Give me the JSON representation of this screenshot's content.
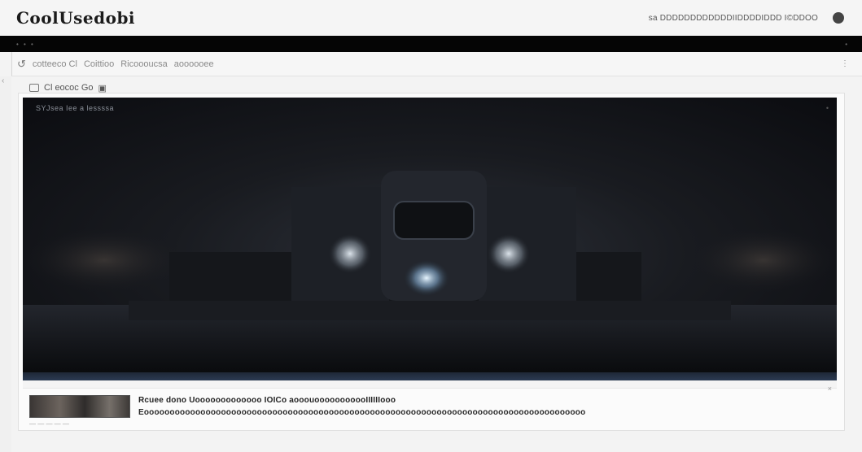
{
  "app": {
    "brand": "CoolUsedobi",
    "header_links": "sa DDDDDDDDDDDDIIDDDDIDDD I©DDOO",
    "profile_icon": "profile-circle-icon"
  },
  "strip": {
    "left": "• • •",
    "right": "•"
  },
  "toolbar": {
    "back_icon": "↺",
    "items": [
      "cotteeco Cl",
      "Coittioo",
      "Ricoooucsa",
      "aoooooee"
    ],
    "menu_icon": "⋮"
  },
  "player": {
    "header_label": "Cl eococ Go",
    "header_icon2": "▣",
    "video_title": "SYJsea Iee a lessssa",
    "corner_text": "•",
    "progress": 0.0
  },
  "item": {
    "title": "Rcuee dono Uooooooooooooo IOICo aooouooooooooooIIIIIIooo",
    "description": "Eoooooooooooooooooooooooooooooooooooooooooooooooooooooooooooooooooooooooooooooooooooooo",
    "close_icon": "×",
    "meta": "— — — — —"
  },
  "colors": {
    "header_bg": "#f5f5f5",
    "strip_bg": "#050505",
    "video_bg": "#141619",
    "progress": "#2b3a52"
  }
}
